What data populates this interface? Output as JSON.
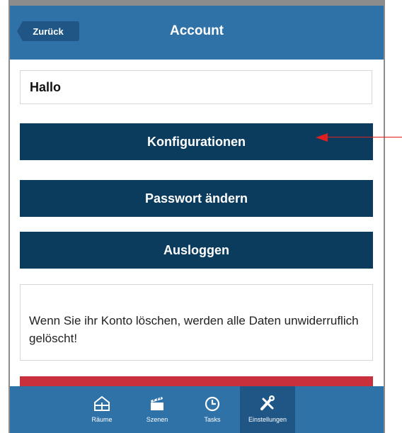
{
  "navbar": {
    "back_label": "Zurück",
    "title": "Account"
  },
  "greeting": "Hallo",
  "buttons": {
    "configurations": "Konfigurationen",
    "change_password": "Passwort ändern",
    "logout": "Ausloggen"
  },
  "warning_text": "Wenn Sie ihr Konto löschen, werden alle Daten unwiderruflich gelöscht!",
  "tabbar": {
    "items": [
      {
        "label": "Räume",
        "icon": "house-icon"
      },
      {
        "label": "Szenen",
        "icon": "clapperboard-icon"
      },
      {
        "label": "Tasks",
        "icon": "clock-icon"
      },
      {
        "label": "Einstellungen",
        "icon": "tools-icon",
        "active": true
      }
    ]
  },
  "colors": {
    "navbar": "#2f72a8",
    "button": "#0c3c5d",
    "delete": "#c8313b",
    "annotation_arrow": "#e02020"
  }
}
